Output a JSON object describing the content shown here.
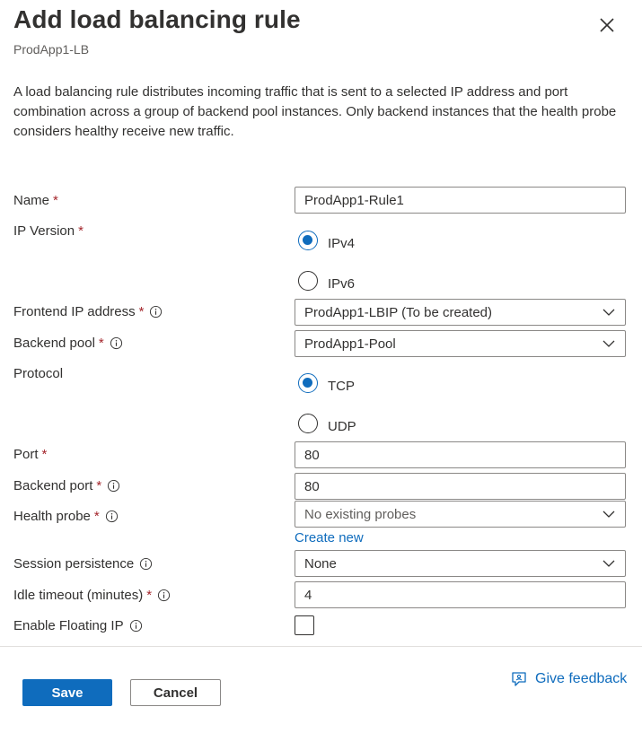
{
  "header": {
    "title": "Add load balancing rule",
    "subtitle": "ProdApp1-LB",
    "close_icon": "close-icon"
  },
  "description": "A load balancing rule distributes incoming traffic that is sent to a selected IP address and port combination across a group of backend pool instances. Only backend instances that the health probe considers healthy receive new traffic.",
  "form": {
    "name": {
      "label": "Name",
      "required": "*",
      "value": "ProdApp1-Rule1"
    },
    "ip_version": {
      "label": "IP Version",
      "required": "*",
      "options": [
        {
          "label": "IPv4",
          "checked": true
        },
        {
          "label": "IPv6",
          "checked": false
        }
      ]
    },
    "frontend_ip": {
      "label": "Frontend IP address",
      "required": "*",
      "value": "ProdApp1-LBIP (To be created)"
    },
    "backend_pool": {
      "label": "Backend pool",
      "required": "*",
      "value": "ProdApp1-Pool"
    },
    "protocol": {
      "label": "Protocol",
      "options": [
        {
          "label": "TCP",
          "checked": true
        },
        {
          "label": "UDP",
          "checked": false
        }
      ]
    },
    "port": {
      "label": "Port",
      "required": "*",
      "value": "80"
    },
    "backend_port": {
      "label": "Backend port",
      "required": "*",
      "value": "80"
    },
    "health_probe": {
      "label": "Health probe",
      "required": "*",
      "value": "No existing probes",
      "create_link": "Create new"
    },
    "session_persistence": {
      "label": "Session persistence",
      "value": "None"
    },
    "idle_timeout": {
      "label": "Idle timeout (minutes)",
      "required": "*",
      "value": "4"
    },
    "floating_ip": {
      "label": "Enable Floating IP",
      "checked": false
    }
  },
  "footer": {
    "save_label": "Save",
    "cancel_label": "Cancel",
    "feedback_label": "Give feedback"
  },
  "colors": {
    "accent": "#0f6cbd",
    "required": "#a4262c",
    "text": "#323130",
    "border": "#8a8886"
  }
}
